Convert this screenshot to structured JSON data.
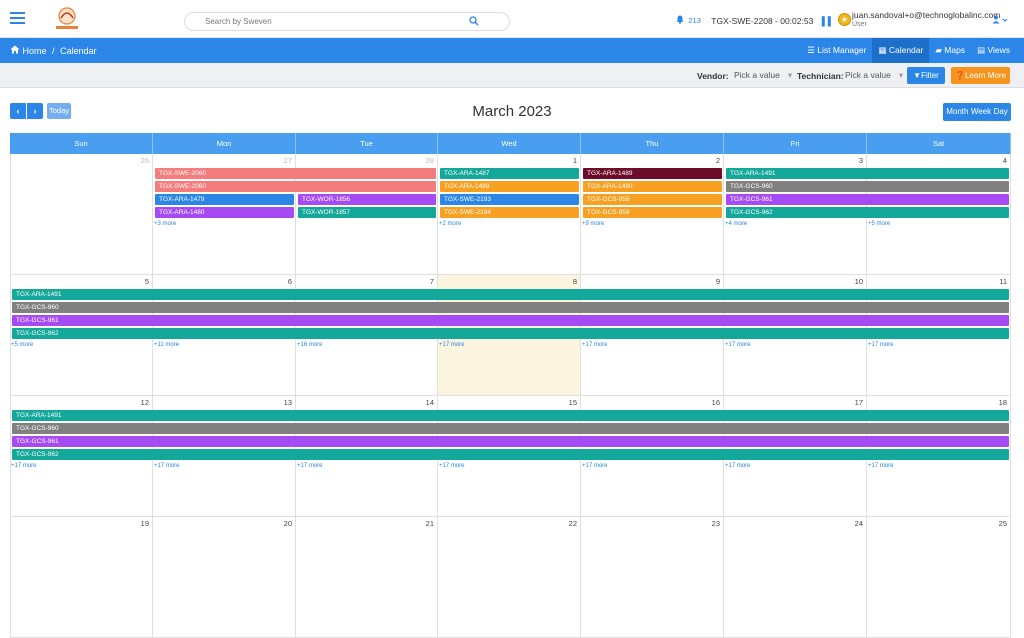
{
  "header": {
    "search_placeholder": "Search by Sweven",
    "notifications": "213",
    "ticket_timer": "TGX-SWE-2208 - 00:02:53",
    "user_email": "juan.sandoval+o@technoglobalinc.com",
    "user_role": "User"
  },
  "nav": {
    "home": "Home",
    "sep": "/",
    "current": "Calendar",
    "links": [
      "List Manager",
      "Calendar",
      "Maps",
      "Views"
    ]
  },
  "filters": {
    "vendor_label": "Vendor:",
    "vendor_value": "Pick a value",
    "technician_label": "Technician:",
    "technician_value": "Pick a value",
    "filter_btn": "Filter",
    "learn_btn": "Learn More"
  },
  "calendar": {
    "today_btn": "Today",
    "title": "March 2023",
    "views": [
      "Month",
      "Week",
      "Day"
    ],
    "days": [
      "Sun",
      "Mon",
      "Tue",
      "Wed",
      "Thu",
      "Fri",
      "Sat"
    ],
    "weeks": [
      {
        "dates": [
          "26",
          "27",
          "28",
          "1",
          "2",
          "3",
          "4"
        ],
        "other": [
          true,
          true,
          true,
          false,
          false,
          false,
          false
        ],
        "events": [
          {
            "label": "TGX-SWE-2060",
            "start": 1,
            "span": 2,
            "row": 0,
            "color": "#f47c7c"
          },
          {
            "label": "TGX-ARA-1487",
            "start": 3,
            "span": 1,
            "row": 0,
            "color": "#14a89a"
          },
          {
            "label": "TGX-ARA-1489",
            "start": 4,
            "span": 1,
            "row": 0,
            "color": "#6d0c2a"
          },
          {
            "label": "TGX-ARA-1491",
            "start": 5,
            "span": 2,
            "row": 0,
            "color": "#14a89a"
          },
          {
            "label": "TGX-SWE-2060",
            "start": 1,
            "span": 2,
            "row": 1,
            "color": "#f47c7c"
          },
          {
            "label": "TGX-ARA-1488",
            "start": 3,
            "span": 1,
            "row": 1,
            "color": "#f7a021"
          },
          {
            "label": "TGX-ARA-1490",
            "start": 4,
            "span": 1,
            "row": 1,
            "color": "#f7a021"
          },
          {
            "label": "TGX-GCS-960",
            "start": 5,
            "span": 2,
            "row": 1,
            "color": "#808080"
          },
          {
            "label": "TGX-ARA-1479",
            "start": 1,
            "span": 1,
            "row": 2,
            "color": "#2b86e8"
          },
          {
            "label": "TGX-WOR-1856",
            "start": 2,
            "span": 1,
            "row": 2,
            "color": "#a64bf4"
          },
          {
            "label": "TGX-SWE-2193",
            "start": 3,
            "span": 1,
            "row": 2,
            "color": "#2b86e8"
          },
          {
            "label": "TGX-GCS-958",
            "start": 4,
            "span": 1,
            "row": 2,
            "color": "#f7a021"
          },
          {
            "label": "TGX-GCS-961",
            "start": 5,
            "span": 2,
            "row": 2,
            "color": "#a64bf4"
          },
          {
            "label": "TGX-ARA-1480",
            "start": 1,
            "span": 1,
            "row": 3,
            "color": "#a64bf4"
          },
          {
            "label": "TGX-WOR-1857",
            "start": 2,
            "span": 1,
            "row": 3,
            "color": "#14a89a"
          },
          {
            "label": "TGX-SWE-2194",
            "start": 3,
            "span": 1,
            "row": 3,
            "color": "#f7a021"
          },
          {
            "label": "TGX-GCS-959",
            "start": 4,
            "span": 1,
            "row": 3,
            "color": "#f7a021"
          },
          {
            "label": "TGX-GCS-962",
            "start": 5,
            "span": 2,
            "row": 3,
            "color": "#14a89a"
          }
        ],
        "more": [
          "",
          "+3 more",
          "",
          "+2 more",
          "+9 more",
          "+4 more",
          "+5 more"
        ]
      },
      {
        "dates": [
          "5",
          "6",
          "7",
          "8",
          "9",
          "10",
          "11"
        ],
        "other": [
          false,
          false,
          false,
          false,
          false,
          false,
          false
        ],
        "today_index": 3,
        "events": [
          {
            "label": "TGX-ARA-1491",
            "start": 0,
            "span": 7,
            "row": 0,
            "color": "#14a89a"
          },
          {
            "label": "TGX-GCS-960",
            "start": 0,
            "span": 7,
            "row": 1,
            "color": "#808080"
          },
          {
            "label": "TGX-GCS-961",
            "start": 0,
            "span": 7,
            "row": 2,
            "color": "#a64bf4"
          },
          {
            "label": "TGX-GCS-962",
            "start": 0,
            "span": 7,
            "row": 3,
            "color": "#14a89a"
          }
        ],
        "more": [
          "+5 more",
          "+11 more",
          "+16 more",
          "+17 more",
          "+17 more",
          "+17 more",
          "+17 more"
        ]
      },
      {
        "dates": [
          "12",
          "13",
          "14",
          "15",
          "16",
          "17",
          "18"
        ],
        "other": [
          false,
          false,
          false,
          false,
          false,
          false,
          false
        ],
        "events": [
          {
            "label": "TGX-ARA-1491",
            "start": 0,
            "span": 7,
            "row": 0,
            "color": "#14a89a"
          },
          {
            "label": "TGX-GCS-960",
            "start": 0,
            "span": 7,
            "row": 1,
            "color": "#808080"
          },
          {
            "label": "TGX-GCS-961",
            "start": 0,
            "span": 7,
            "row": 2,
            "color": "#a64bf4"
          },
          {
            "label": "TGX-GCS-962",
            "start": 0,
            "span": 7,
            "row": 3,
            "color": "#14a89a"
          }
        ],
        "more": [
          "+17 more",
          "+17 more",
          "+17 more",
          "+17 more",
          "+17 more",
          "+17 more",
          "+17 more"
        ]
      },
      {
        "dates": [
          "19",
          "20",
          "21",
          "22",
          "23",
          "24",
          "25"
        ],
        "other": [
          false,
          false,
          false,
          false,
          false,
          false,
          false
        ],
        "events": [],
        "more": [
          "",
          "",
          "",
          "",
          "",
          "",
          ""
        ]
      }
    ]
  }
}
